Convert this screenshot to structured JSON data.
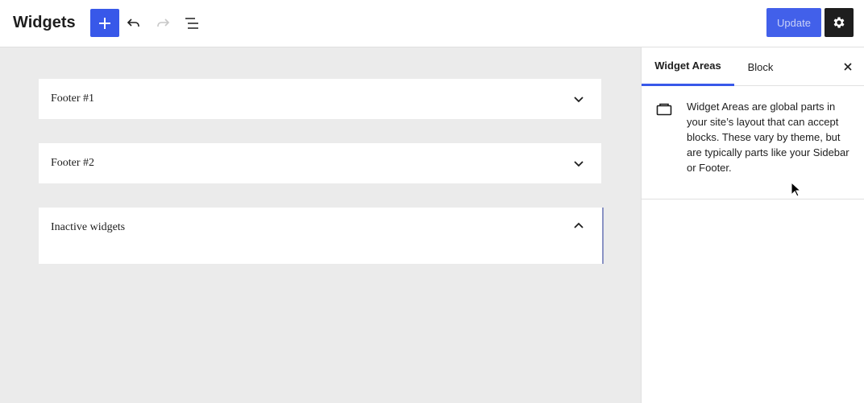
{
  "header": {
    "title": "Widgets",
    "update_label": "Update",
    "icons": {
      "add": "plus-icon",
      "undo": "undo-icon",
      "redo": "redo-icon",
      "list_view": "list-view-icon",
      "settings": "gear-icon"
    }
  },
  "widget_areas": [
    {
      "title": "Footer #1",
      "expanded": false
    },
    {
      "title": "Footer #2",
      "expanded": false
    },
    {
      "title": "Inactive widgets",
      "expanded": true
    }
  ],
  "sidebar": {
    "tabs": [
      {
        "label": "Widget Areas",
        "active": true
      },
      {
        "label": "Block",
        "active": false
      }
    ],
    "description": "Widget Areas are global parts in your site’s layout that can accept blocks. These vary by theme, but are typically parts like your Sidebar or Footer.",
    "icons": {
      "close": "close-icon",
      "widget_area": "widget-area-icon"
    }
  },
  "colors": {
    "accent": "#3858e9",
    "canvas_bg": "#ebebeb",
    "dark_button": "#1e1e1e"
  }
}
